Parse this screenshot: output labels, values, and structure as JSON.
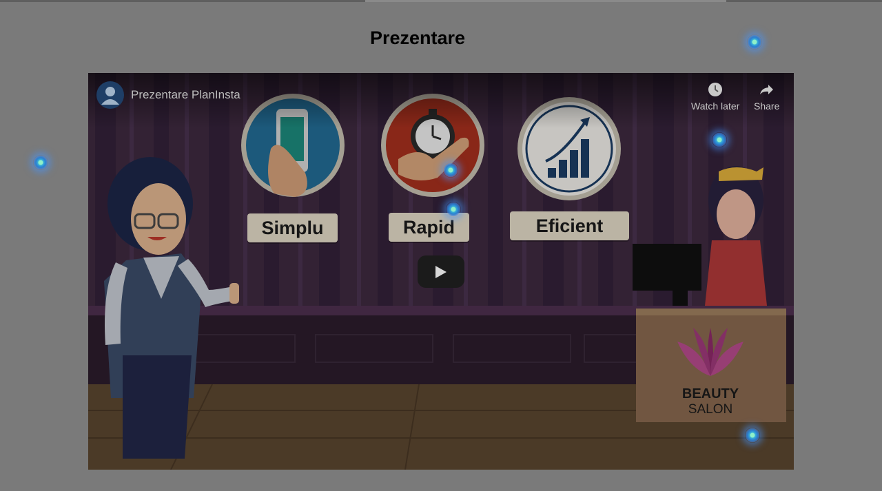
{
  "page": {
    "title": "Prezentare",
    "background": "#7a7a7a"
  },
  "video": {
    "title": "Prezentare PlanInsta",
    "actions": [
      {
        "label": "Watch later",
        "icon": "clock-icon"
      },
      {
        "label": "Share",
        "icon": "share-arrow-icon"
      }
    ],
    "play_icon": "play-icon",
    "scene": {
      "labels": [
        "Simplu",
        "Rapid",
        "Eficient"
      ],
      "salon_name_line1": "BEAUTY",
      "salon_name_line2": "SALON"
    }
  },
  "interaction_markers": {
    "count": 7,
    "color": "#3a8fe0"
  }
}
